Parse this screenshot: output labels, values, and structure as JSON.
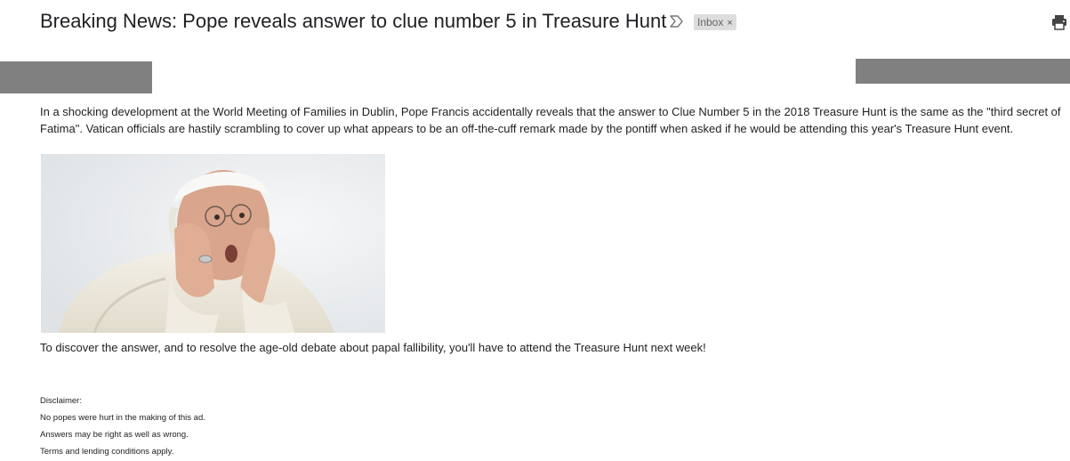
{
  "email": {
    "subject": "Breaking News: Pope reveals answer to clue number 5 in Treasure Hunt",
    "label_chip": "Inbox",
    "label_remove": "×",
    "body_paragraph": "In a shocking development at the World Meeting of Families in Dublin, Pope Francis accidentally reveals that the answer to Clue Number 5 in the 2018 Treasure Hunt is the same as the \"third secret of Fatima\".   Vatican officials are hastily scrambling to cover up what appears to be an off-the-cuff remark made by the pontiff when asked if he would be attending this year's Treasure Hunt event.",
    "followup": "To discover the answer, and to resolve the age-old debate about papal fallibility,  you'll have to attend the Treasure Hunt next week!",
    "disclaimer": {
      "heading": "Disclaimer:",
      "lines": [
        "No popes were hurt in the making of this ad.",
        "Answers may be right as well as wrong.",
        "Terms and lending conditions apply."
      ]
    }
  },
  "icons": {
    "importance": "importance-marker-icon",
    "print": "print-icon"
  },
  "colors": {
    "redaction": "#808080",
    "chip_bg": "#dddddd",
    "text": "#222222"
  }
}
